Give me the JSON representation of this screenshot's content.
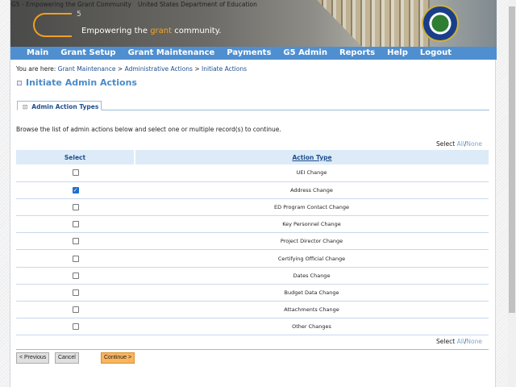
{
  "header": {
    "logo_alt": "G5 - Empowering the Grant Community",
    "seal_alt": "United States Department of Education",
    "logo_sup": "5",
    "tagline_pre": "Empowering the ",
    "tagline_accent": "grant",
    "tagline_post": " community."
  },
  "nav": [
    "Main",
    "Grant Setup",
    "Grant Maintenance",
    "Payments",
    "G5 Admin",
    "Reports",
    "Help",
    "Logout"
  ],
  "breadcrumb": {
    "prefix": "You are here: ",
    "items": [
      "Grant Maintenance",
      "Administrative Actions",
      "Initiate Actions"
    ],
    "sep": " > "
  },
  "page_title": "Initiate Admin Actions",
  "tab": "Admin Action Types",
  "instructions": "Browse the list of admin actions below and select one or multiple record(s) to continue.",
  "select_links": {
    "label": "Select ",
    "all": "All",
    "slash": "/",
    "none": "None"
  },
  "table": {
    "headers": [
      "Select",
      "Action Type"
    ],
    "rows": [
      {
        "label": "UEI Change",
        "checked": false
      },
      {
        "label": "Address Change",
        "checked": true
      },
      {
        "label": "ED Program Contact Change",
        "checked": false
      },
      {
        "label": "Key Personnel Change",
        "checked": false
      },
      {
        "label": "Project Director Change",
        "checked": false
      },
      {
        "label": "Certifying Official Change",
        "checked": false
      },
      {
        "label": "Dates Change",
        "checked": false
      },
      {
        "label": "Budget Data Change",
        "checked": false
      },
      {
        "label": "Attachments Change",
        "checked": false
      },
      {
        "label": "Other Changes",
        "checked": false
      }
    ]
  },
  "buttons": {
    "previous": "< Previous",
    "cancel": "Cancel",
    "continue": "Continue >"
  },
  "colors": {
    "nav": "#4f8fd0",
    "title": "#4a8bc8",
    "continue": "#f9b45c",
    "accent": "#f5a623"
  }
}
